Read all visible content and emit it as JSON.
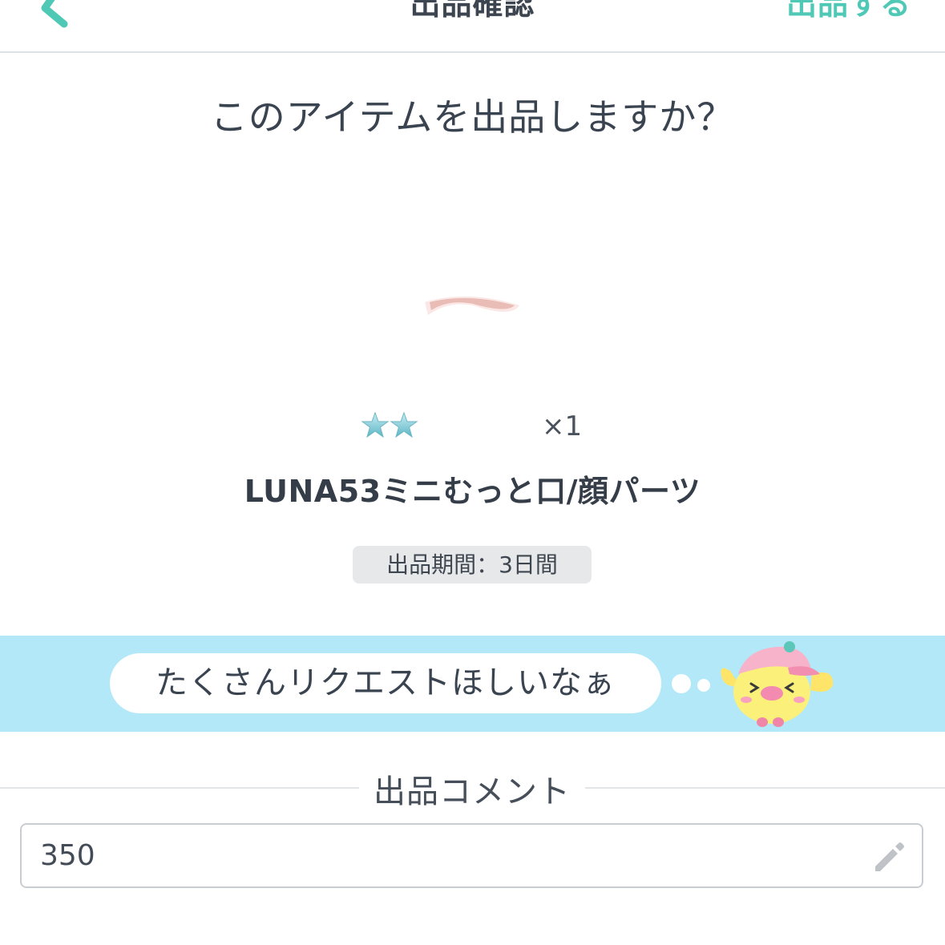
{
  "header": {
    "title": "出品確認",
    "submit_label": "出品する",
    "back_icon": "chevron-left-icon",
    "accent_color": "#4fc9b6"
  },
  "question": "このアイテムを出品しますか？",
  "item": {
    "image_icon": "mouth-part-icon",
    "rarity_stars": 2,
    "quantity": "×1",
    "name": "LUNA53ミニむっと口/顔パーツ",
    "period": "出品期間：3日間"
  },
  "banner": {
    "message": "たくさんリクエストほしいなぁ",
    "mascot_icon": "chick-mascot-icon",
    "background_color": "#b3e8f8"
  },
  "comment": {
    "section_title": "出品コメント",
    "value": "350",
    "edit_icon": "pencil-icon"
  }
}
